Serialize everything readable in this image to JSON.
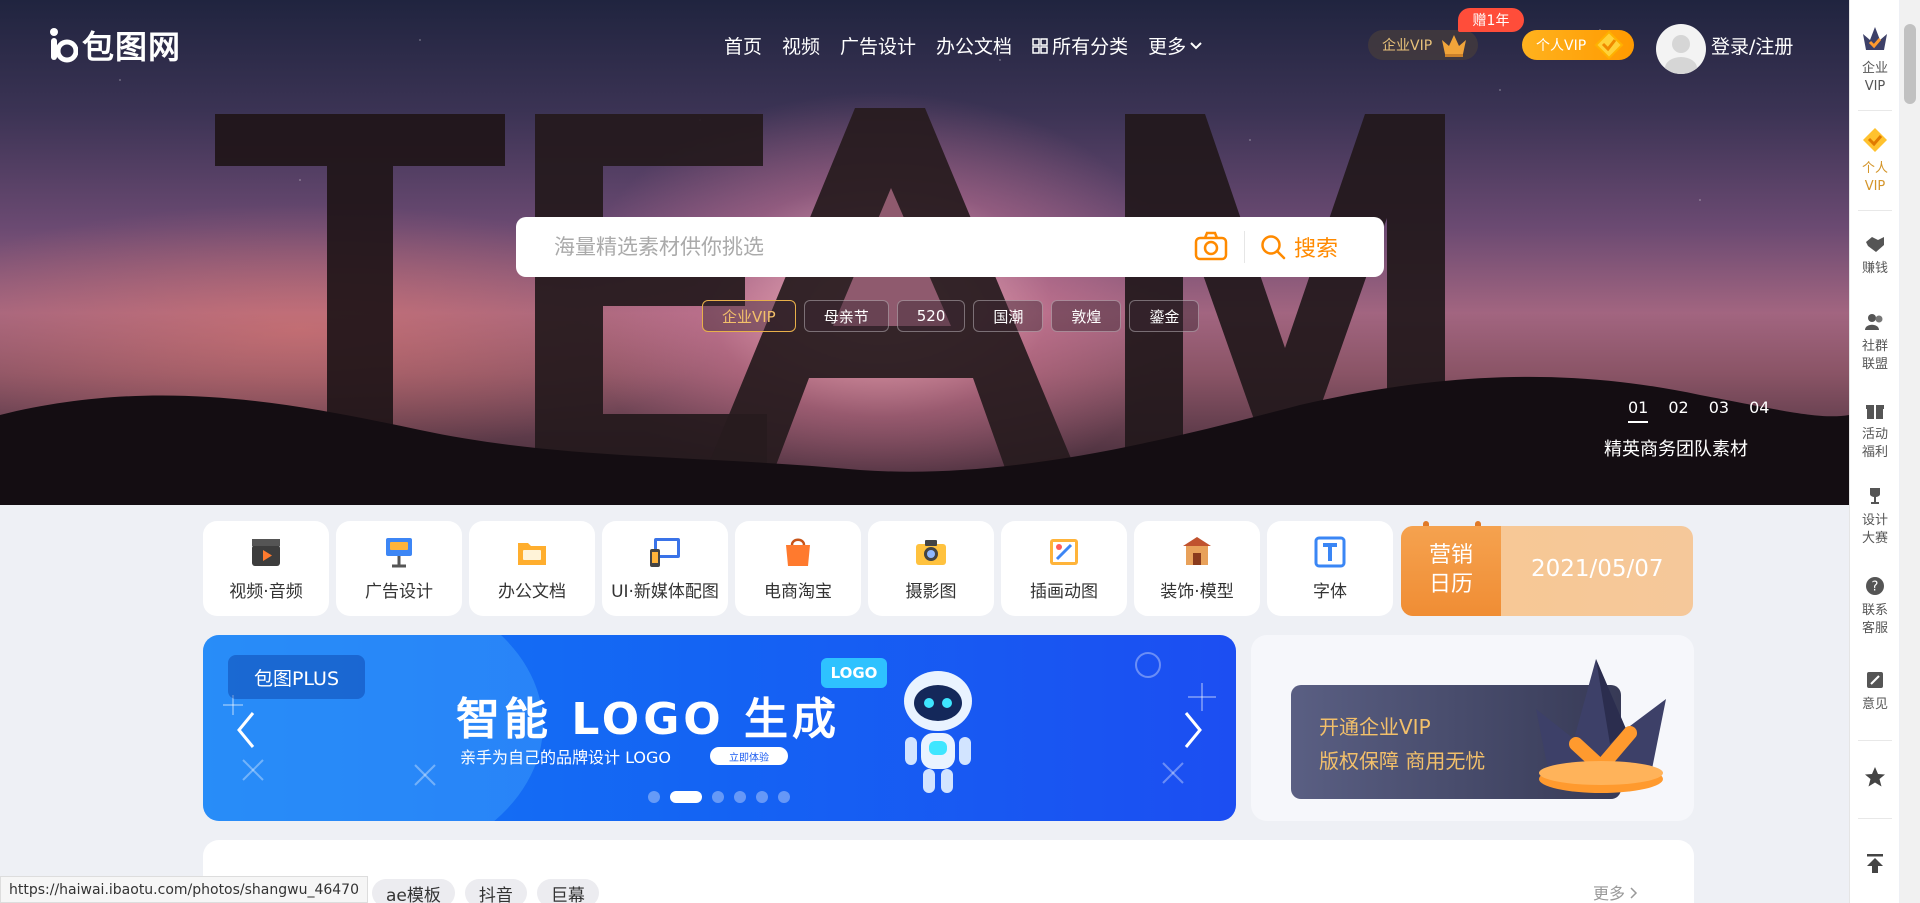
{
  "brand": {
    "name": "包图网"
  },
  "nav": {
    "items": [
      "首页",
      "视频",
      "广告设计",
      "办公文档",
      "所有分类",
      "更多"
    ]
  },
  "header": {
    "enterprise_vip": "企业VIP",
    "enterprise_badge": "赠1年",
    "personal_vip": "个人VIP",
    "login": "登录/注册"
  },
  "hero": {
    "search_placeholder": "海量精选素材供你挑选",
    "search_button": "搜索",
    "tags": [
      "企业VIP",
      "母亲节",
      "520",
      "国潮",
      "敦煌",
      "鎏金"
    ],
    "active_tag": "企业VIP",
    "slides": [
      "01",
      "02",
      "03",
      "04"
    ],
    "active_slide": "01",
    "caption": "精英商务团队素材",
    "background_text": "TEAM"
  },
  "categories": [
    {
      "label": "视频·音频",
      "icon": "video-icon"
    },
    {
      "label": "广告设计",
      "icon": "ad-icon"
    },
    {
      "label": "办公文档",
      "icon": "office-icon"
    },
    {
      "label": "UI·新媒体配图",
      "icon": "ui-icon"
    },
    {
      "label": "电商淘宝",
      "icon": "shop-icon"
    },
    {
      "label": "摄影图",
      "icon": "camera-icon"
    },
    {
      "label": "插画动图",
      "icon": "illustration-icon"
    },
    {
      "label": "装饰·模型",
      "icon": "decor-icon"
    },
    {
      "label": "字体",
      "icon": "font-icon"
    }
  ],
  "calendar": {
    "title_line1": "营销",
    "title_line2": "日历",
    "date": "2021/05/07"
  },
  "banner": {
    "tag": "包图PLUS",
    "title": "智能 LOGO 生成",
    "subtitle": "亲手为自己的品牌设计 LOGO",
    "cta": "立即体验",
    "bubble": "LOGO",
    "dot_count": 6,
    "active_dot": 2
  },
  "vip_card": {
    "line1": "开通企业VIP",
    "line2": "版权保障 商用无忧"
  },
  "bottom": {
    "tags": [
      "ae模板",
      "抖音",
      "巨幕"
    ],
    "more": "更多"
  },
  "status_url": "https://haiwai.ibaotu.com/photos/shangwu_46470",
  "sidebar": {
    "items": [
      {
        "label": "企业\nVIP",
        "icon": "crown-icon"
      },
      {
        "label": "个人\nVIP",
        "icon": "diamond-icon"
      },
      {
        "label": "赚钱",
        "icon": "handshake-icon"
      },
      {
        "label": "社群\n联盟",
        "icon": "group-icon"
      },
      {
        "label": "活动\n福利",
        "icon": "gift-icon"
      },
      {
        "label": "设计\n大赛",
        "icon": "trophy-icon"
      },
      {
        "label": "联系\n客服",
        "icon": "help-icon"
      },
      {
        "label": "意见",
        "icon": "feedback-icon"
      },
      {
        "label": "",
        "icon": "star-icon"
      },
      {
        "label": "",
        "icon": "back-to-top-icon"
      }
    ]
  },
  "colors": {
    "accent": "#ff8a00",
    "banner_blue": "#1463f3",
    "gold": "#f3c06a"
  }
}
